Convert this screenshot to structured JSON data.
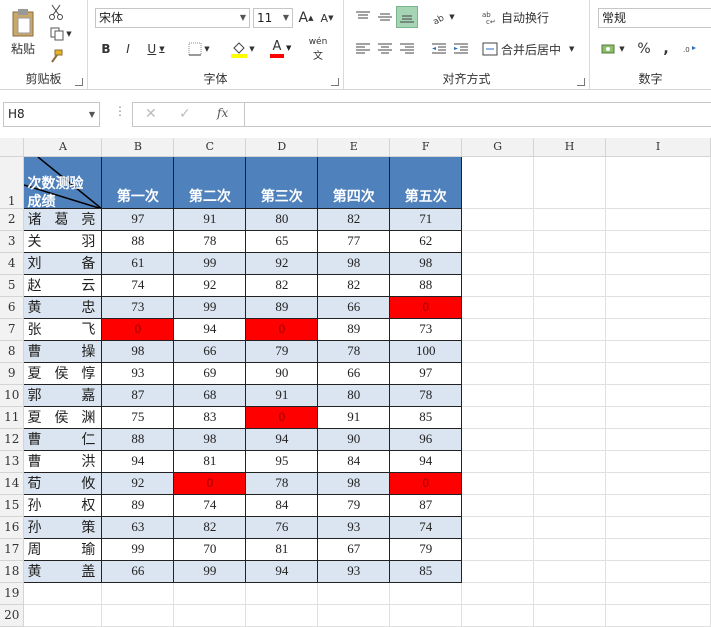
{
  "ribbon": {
    "clipboard": {
      "group_label": "剪贴板",
      "paste_label": "粘贴"
    },
    "font": {
      "group_label": "字体",
      "font_name": "宋体",
      "font_size": "11",
      "grow_label": "A",
      "shrink_label": "A",
      "bold_label": "B",
      "italic_label": "I",
      "underline_label": "U",
      "font_color_label": "A",
      "phonetic_label": "wén",
      "fill_color": "#ffff00",
      "font_color": "#ff0000"
    },
    "alignment": {
      "group_label": "对齐方式",
      "wrap_label": "自动换行",
      "merge_label": "合并后居中"
    },
    "number": {
      "group_label": "数字",
      "format": "常规",
      "percent_label": "%",
      "comma_label": ","
    }
  },
  "formula_bar": {
    "name_box": "H8",
    "fx_label": "fx",
    "formula": ""
  },
  "columns": [
    "A",
    "B",
    "C",
    "D",
    "E",
    "F",
    "G",
    "H",
    "I"
  ],
  "header": {
    "diag_top": "次数测验",
    "diag_bottom": "成绩",
    "col_titles": [
      "第一次",
      "第二次",
      "第三次",
      "第四次",
      "第五次"
    ]
  },
  "rows": [
    {
      "name": "诸葛亮",
      "scores": [
        "97",
        "91",
        "80",
        "82",
        "71"
      ]
    },
    {
      "name": "关羽",
      "scores": [
        "88",
        "78",
        "65",
        "77",
        "62"
      ]
    },
    {
      "name": "刘备",
      "scores": [
        "61",
        "99",
        "92",
        "98",
        "98"
      ]
    },
    {
      "name": "赵云",
      "scores": [
        "74",
        "92",
        "82",
        "82",
        "88"
      ]
    },
    {
      "name": "黄忠",
      "scores": [
        "73",
        "99",
        "89",
        "66",
        "0"
      ]
    },
    {
      "name": "张飞",
      "scores": [
        "0",
        "94",
        "0",
        "89",
        "73"
      ]
    },
    {
      "name": "曹操",
      "scores": [
        "98",
        "66",
        "79",
        "78",
        "100"
      ]
    },
    {
      "name": "夏侯惇",
      "scores": [
        "93",
        "69",
        "90",
        "66",
        "97"
      ]
    },
    {
      "name": "郭嘉",
      "scores": [
        "87",
        "68",
        "91",
        "80",
        "78"
      ]
    },
    {
      "name": "夏侯渊",
      "scores": [
        "75",
        "83",
        "0",
        "91",
        "85"
      ]
    },
    {
      "name": "曹仁",
      "scores": [
        "88",
        "98",
        "94",
        "90",
        "96"
      ]
    },
    {
      "name": "曹洪",
      "scores": [
        "94",
        "81",
        "95",
        "84",
        "94"
      ]
    },
    {
      "name": "荀攸",
      "scores": [
        "92",
        "0",
        "78",
        "98",
        "0"
      ]
    },
    {
      "name": "孙权",
      "scores": [
        "89",
        "74",
        "84",
        "79",
        "87"
      ]
    },
    {
      "name": "孙策",
      "scores": [
        "63",
        "82",
        "76",
        "93",
        "74"
      ]
    },
    {
      "name": "周瑜",
      "scores": [
        "99",
        "70",
        "81",
        "67",
        "79"
      ]
    },
    {
      "name": "黄盖",
      "scores": [
        "66",
        "99",
        "94",
        "93",
        "85"
      ]
    }
  ],
  "row_numbers": [
    "1",
    "2",
    "3",
    "4",
    "5",
    "6",
    "7",
    "8",
    "9",
    "10",
    "11",
    "12",
    "13",
    "14",
    "15",
    "16",
    "17",
    "18",
    "19",
    "20"
  ],
  "highlight_color": "#ff0000",
  "header_fill": "#4f81bd",
  "band_fill": "#dbe5f1"
}
